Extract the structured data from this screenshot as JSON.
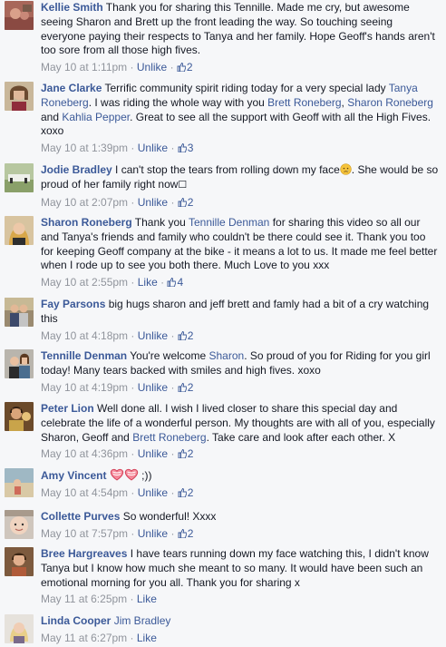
{
  "comments": [
    {
      "author": "Kellie Smith",
      "parts": [
        " Thank you for sharing this Tennille. Made me cry, but awesome seeing Sharon and Brett up the front leading the way. So touching seeing everyone paying their respects to Tanya and her family. Hope Geoff's hands aren't too sore from all those high fives."
      ],
      "time": "May 10 at 1:11pm",
      "action": "Unlike",
      "likes": "2"
    },
    {
      "author": "Jane Clarke",
      "t1": " Terrific community spirit riding today for a very special lady ",
      "m1": "Tanya Roneberg",
      "t2": ". I was riding the whole way with you ",
      "m2": "Brett Roneberg",
      "t3": ", ",
      "m3": "Sharon Roneberg",
      "t4": " and ",
      "m4": "Kahlia Pepper",
      "t5": ". Great to see all the support with Geoff with all the High Fives. xoxo",
      "time": "May 10 at 1:39pm",
      "action": "Unlike",
      "likes": "3"
    },
    {
      "author": "Jodie Bradley",
      "t1": " I can't stop the tears from rolling down my face",
      "t2": ". She would be so proud of her family right now",
      "t3": "☐",
      "time": "May 10 at 2:07pm",
      "action": "Unlike",
      "likes": "2"
    },
    {
      "author": "Sharon Roneberg",
      "t1": " Thank you ",
      "m1": "Tennille Denman",
      "t2": " for sharing this video so all our and Tanya's friends and family who couldn't be there could see it. Thank you too for keeping Geoff company at the bike - it means a lot to us. It made me feel better when I rode up to see you both there. Much Love to you xxx",
      "time": "May 10 at 2:55pm",
      "action": "Like",
      "likes": "4"
    },
    {
      "author": "Fay Parsons",
      "t1": " big hugs sharon and jeff brett and famly had a bit of a cry watching this",
      "time": "May 10 at 4:18pm",
      "action": "Unlike",
      "likes": "2"
    },
    {
      "author": "Tennille Denman",
      "t1": " You're welcome ",
      "m1": "Sharon",
      "t2": ". So proud of you for Riding for you girl today! Many tears backed with smiles and high fives. xoxo",
      "time": "May 10 at 4:19pm",
      "action": "Unlike",
      "likes": "2"
    },
    {
      "author": "Peter Lion",
      "t1": " Well done all. I wish I lived closer to share this special day and celebrate the life of a wonderful person. My thoughts are with all of you, especially Sharon, Geoff and ",
      "m1": "Brett Roneberg",
      "t2": ". Take care and look after each other. X",
      "time": "May 10 at 4:36pm",
      "action": "Unlike",
      "likes": "2"
    },
    {
      "author": "Amy Vincent",
      "t1": " ;))",
      "time": "May 10 at 4:54pm",
      "action": "Unlike",
      "likes": "2"
    },
    {
      "author": "Collette Purves",
      "t1": " So wonderful! Xxxx",
      "time": "May 10 at 7:57pm",
      "action": "Unlike",
      "likes": "2"
    },
    {
      "author": "Bree Hargreaves",
      "t1": " I have tears running down my face watching this, I didn't know Tanya but I know how much she meant to so many. It would have been such an emotional morning for you all. Thank you for sharing x",
      "time": "May 11 at 6:25pm",
      "action": "Like",
      "likes": ""
    },
    {
      "author": "Linda Cooper",
      "t1": " ",
      "m1": "Jim Bradley",
      "time": "May 11 at 6:27pm",
      "action": "Like",
      "likes": ""
    }
  ],
  "separator": "·",
  "colors": {
    "link": "#3b5998",
    "meta": "#90949c",
    "text": "#141823",
    "background": "#f6f7f9"
  }
}
